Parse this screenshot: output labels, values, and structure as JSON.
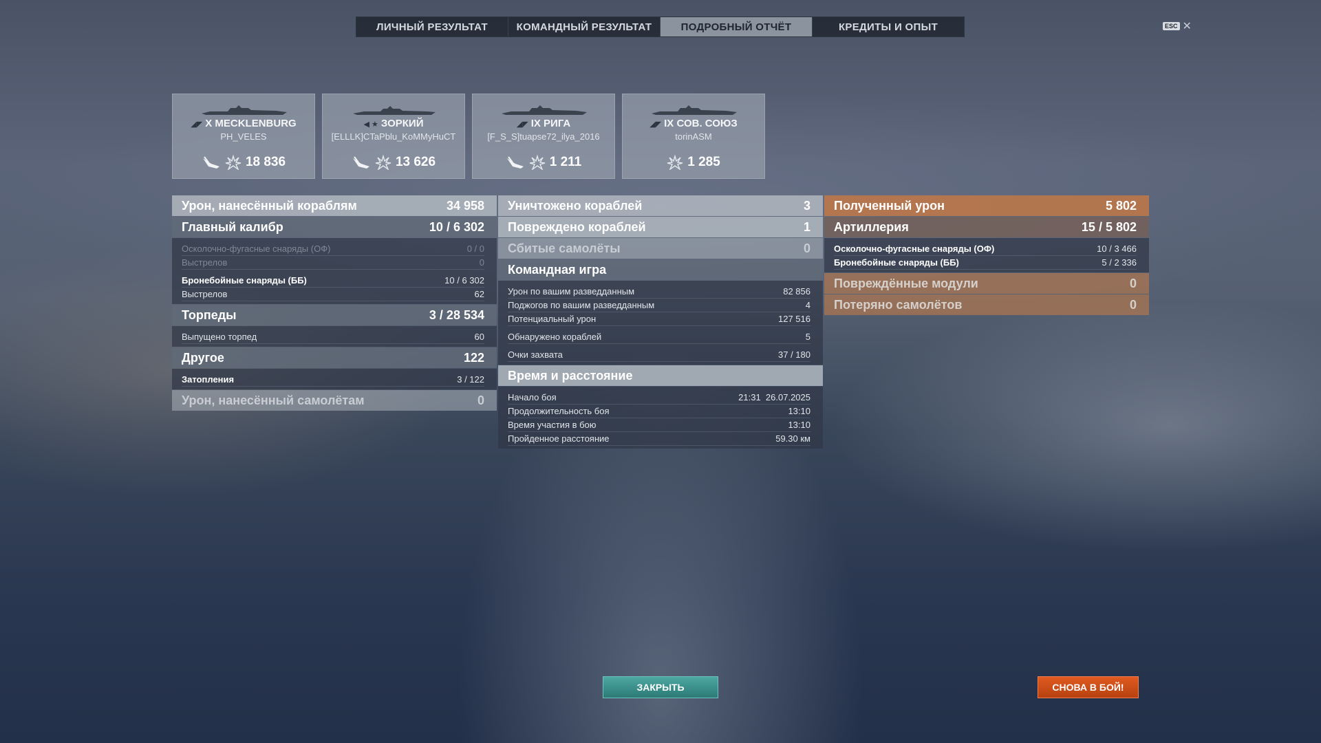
{
  "tabs": [
    {
      "label": "ЛИЧНЫЙ РЕЗУЛЬТАТ"
    },
    {
      "label": "КОМАНДНЫЙ РЕЗУЛЬТАТ"
    },
    {
      "label": "ПОДРОБНЫЙ ОТЧЁТ",
      "active": true
    },
    {
      "label": "КРЕДИТЫ И ОПЫТ"
    }
  ],
  "esc": {
    "key": "ESC",
    "close": "✕"
  },
  "ships": [
    {
      "class_tier": "X",
      "name": "X MECKLENBURG",
      "player": "PH_VELES",
      "damage": "18 836",
      "has_plane_icon": true
    },
    {
      "class_tier": "★",
      "name": "ЗОРКИЙ",
      "player": "[ELLLK]CTaPblu_KoMMyHuCT",
      "damage": "13 626",
      "has_plane_icon": true
    },
    {
      "class_tier": "IX",
      "name": "IX РИГА",
      "player": "[F_S_S]tuapse72_ilya_2016",
      "damage": "1 211",
      "has_plane_icon": true
    },
    {
      "class_tier": "IX",
      "name": "IX СОВ. СОЮЗ",
      "player": "torinASM",
      "damage": "1 285",
      "has_plane_icon": false
    }
  ],
  "left": {
    "damage_to_ships": {
      "label": "Урон, нанесённый кораблям",
      "value": "34 958"
    },
    "main_battery": {
      "label": "Главный калибр",
      "value": "10 / 6 302"
    },
    "he": {
      "label": "Осколочно-фугасные снаряды (ОФ)",
      "value": "0 / 0"
    },
    "he_shots": {
      "label": "Выстрелов",
      "value": "0"
    },
    "ap": {
      "label": "Бронебойные снаряды (ББ)",
      "value": "10 / 6 302"
    },
    "ap_shots": {
      "label": "Выстрелов",
      "value": "62"
    },
    "torpedoes": {
      "label": "Торпеды",
      "value": "3 / 28 534"
    },
    "torps_fired": {
      "label": "Выпущено торпед",
      "value": "60"
    },
    "other": {
      "label": "Другое",
      "value": "122"
    },
    "flooding": {
      "label": "Затопления",
      "value": "3 / 122"
    },
    "damage_to_planes": {
      "label": "Урон, нанесённый самолётам",
      "value": "0"
    }
  },
  "middle": {
    "destroyed": {
      "label": "Уничтожено кораблей",
      "value": "3"
    },
    "damaged": {
      "label": "Повреждено кораблей",
      "value": "1"
    },
    "planes_shot": {
      "label": "Сбитые самолёты",
      "value": "0"
    },
    "teamplay": {
      "label": "Командная игра"
    },
    "spot_damage": {
      "label": "Урон по вашим разведданным",
      "value": "82 856"
    },
    "spot_fires": {
      "label": "Поджогов по вашим разведданным",
      "value": "4"
    },
    "potential": {
      "label": "Потенциальный урон",
      "value": "127 516"
    },
    "detected": {
      "label": "Обнаружено кораблей",
      "value": "5"
    },
    "capture": {
      "label": "Очки захвата",
      "value": "37 / 180"
    },
    "time_dist": {
      "label": "Время и расстояние"
    },
    "battle_start": {
      "label": "Начало боя",
      "value": "21:31  26.07.2025"
    },
    "duration": {
      "label": "Продолжительность боя",
      "value": "13:10"
    },
    "participation": {
      "label": "Время участия в бою",
      "value": "13:10"
    },
    "distance": {
      "label": "Пройденное расстояние",
      "value": "59.30 км"
    }
  },
  "right": {
    "received": {
      "label": "Полученный урон",
      "value": "5 802"
    },
    "artillery": {
      "label": "Артиллерия",
      "value": "15 / 5 802"
    },
    "he": {
      "label": "Осколочно-фугасные снаряды (ОФ)",
      "value": "10 / 3 466"
    },
    "ap": {
      "label": "Бронебойные снаряды (ББ)",
      "value": "5 / 2 336"
    },
    "modules": {
      "label": "Повреждённые модули",
      "value": "0"
    },
    "planes_lost": {
      "label": "Потеряно самолётов",
      "value": "0"
    }
  },
  "buttons": {
    "close": "ЗАКРЫТЬ",
    "battle_again": "СНОВА В БОЙ!"
  },
  "colors": {
    "accent_orange": "#c8511a",
    "accent_teal": "#3c9893",
    "active_tab": "#8a939e"
  }
}
